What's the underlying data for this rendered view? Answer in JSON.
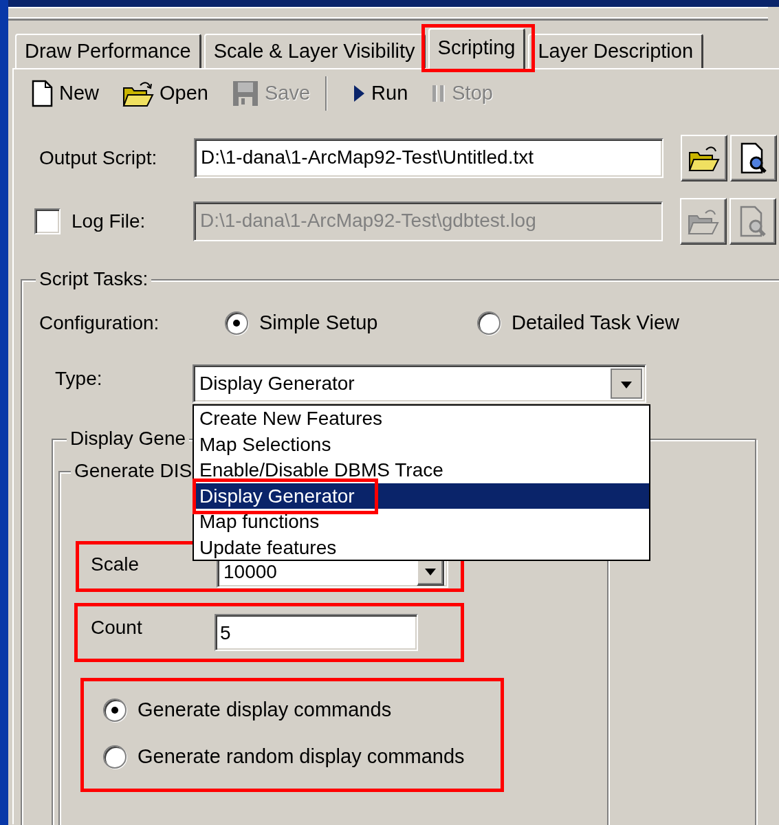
{
  "tabs": [
    {
      "label": "Draw Performance",
      "selected": false,
      "highlighted": false
    },
    {
      "label": "Scale & Layer Visibility",
      "selected": false,
      "highlighted": false
    },
    {
      "label": "Scripting",
      "selected": true,
      "highlighted": true
    },
    {
      "label": "Layer Description",
      "selected": false,
      "highlighted": false
    }
  ],
  "toolbar": [
    {
      "kind": "new",
      "label": "New",
      "disabled": false
    },
    {
      "kind": "open",
      "label": "Open",
      "disabled": false
    },
    {
      "kind": "save",
      "label": "Save",
      "disabled": true
    },
    {
      "kind": "separator"
    },
    {
      "kind": "run",
      "label": "Run",
      "disabled": false
    },
    {
      "kind": "stop",
      "label": "Stop",
      "disabled": true
    }
  ],
  "output_script": {
    "label": "Output Script:",
    "value": "D:\\1-dana\\1-ArcMap92-Test\\Untitled.txt",
    "disabled": false
  },
  "log_file": {
    "label": "Log File:",
    "checked": false,
    "value": "D:\\1-dana\\1-ArcMap92-Test\\gdbtest.log",
    "disabled": true
  },
  "script_tasks": {
    "title": "Script Tasks:",
    "configuration": {
      "label": "Configuration:",
      "options": [
        {
          "label": "Simple Setup",
          "selected": true
        },
        {
          "label": "Detailed Task View",
          "selected": false
        }
      ]
    },
    "type": {
      "label": "Type:",
      "value": "Display Generator",
      "expanded": true,
      "options": [
        {
          "label": "Create New Features",
          "selected": false,
          "highlighted": false
        },
        {
          "label": "Map Selections",
          "selected": false,
          "highlighted": false
        },
        {
          "label": "Enable/Disable DBMS Trace",
          "selected": false,
          "highlighted": false
        },
        {
          "label": "Display Generator",
          "selected": true,
          "highlighted": true
        },
        {
          "label": "Map functions",
          "selected": false,
          "highlighted": false
        },
        {
          "label": "Update features",
          "selected": false,
          "highlighted": false
        }
      ]
    },
    "display_group": {
      "title": "Display Gene",
      "subgroup_title": "Generate DIS",
      "scale": {
        "label": "Scale",
        "value": "10000",
        "highlighted": true
      },
      "count": {
        "label": "Count",
        "value": "5",
        "highlighted": true
      },
      "modes": {
        "highlighted": true,
        "options": [
          {
            "label": "Generate display commands",
            "selected": true
          },
          {
            "label": "Generate random display commands",
            "selected": false
          }
        ]
      }
    }
  }
}
